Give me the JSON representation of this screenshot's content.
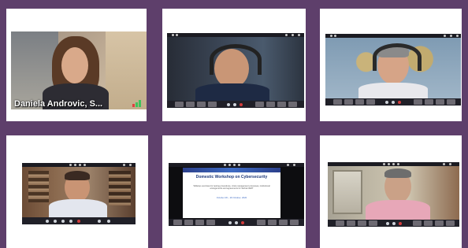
{
  "participants": [
    {
      "tile": 1,
      "name_label": "Daniela Androvic, S...",
      "kind": "camera"
    },
    {
      "tile": 2,
      "kind": "camera"
    },
    {
      "tile": 3,
      "kind": "camera"
    },
    {
      "tile": 4,
      "kind": "camera"
    },
    {
      "tile": 5,
      "kind": "screen-share",
      "slide": {
        "title_line1": "Domestic Workshop on Cybersecurity",
        "subtitle": "Tabletop exercises for testing procedures, crisis management processes, institutional arrangements and agreements for Serbia CERT",
        "date": "October 28 – 29 October, 2020"
      }
    },
    {
      "tile": 6,
      "kind": "camera"
    }
  ],
  "colors": {
    "background": "#5e3f6b",
    "tile": "#ffffff",
    "video_frame": "#0d0d10"
  },
  "icons": [
    "microphone-icon",
    "camera-icon",
    "share-screen-icon",
    "participants-icon",
    "leave-call-icon",
    "audio-level-icon"
  ]
}
